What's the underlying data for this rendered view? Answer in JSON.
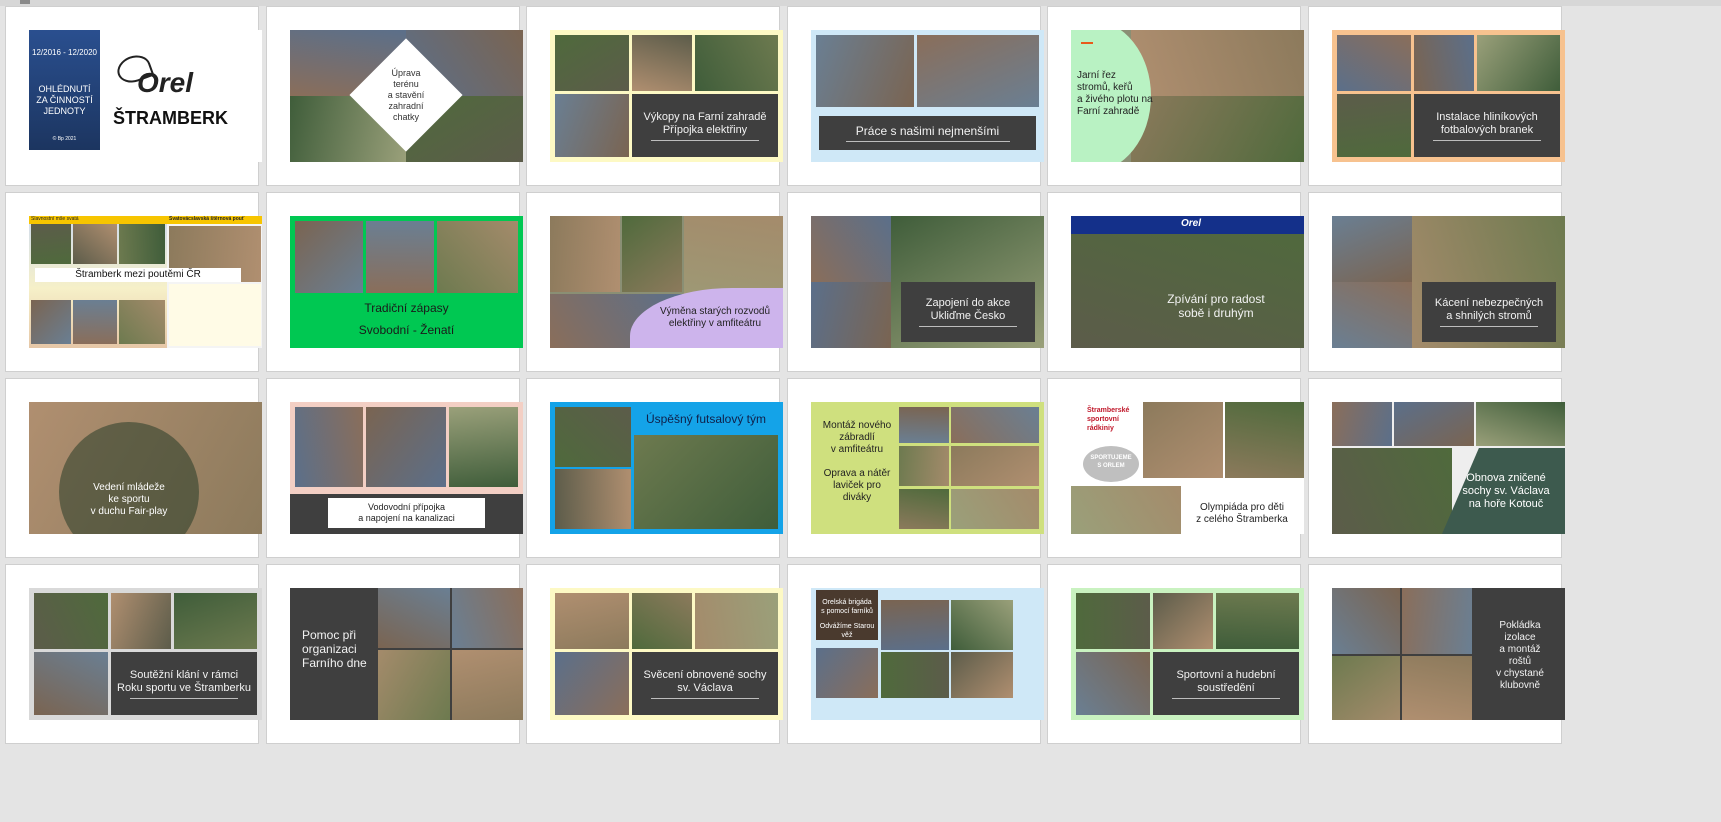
{
  "slides": [
    {
      "kind": "title",
      "date_range": "12/2016 - 12/2020",
      "title": "OHLÉDNUTÍ\nZA ČINNOSTÍ\nJEDNOTY",
      "copyright": "© Bp 2021",
      "logo_word": "Orel",
      "club_name": "ŠTRAMBERK"
    },
    {
      "kind": "diamond",
      "caption": "Úprava\nterénu\na stavění\nzahradní\nchatky"
    },
    {
      "kind": "box-right",
      "accent": "#fdf9c4",
      "caption": "Výkopy na Farní zahradě\nPřípojka elektřiny"
    },
    {
      "kind": "box-bottom",
      "accent": "#cfe8f7",
      "caption": "Práce s našimi nejmenšími"
    },
    {
      "kind": "green-left",
      "accent": "#b9f2c3",
      "caption": "Jarní řez\nstromů, keřů\na živého plotu na\nFarní zahradě"
    },
    {
      "kind": "box-right",
      "accent": "#f7c28f",
      "caption": "Instalace hliníkových\nfotbalových branek"
    },
    {
      "kind": "poster",
      "caption": "Štramberk mezi poutěmi ČR",
      "poster_header_left": "Slavnostní mše svatá",
      "poster_header_right": "Svatovácslavská štěrnová pouť"
    },
    {
      "kind": "green-bottom",
      "accent": "#00c852",
      "caption_line1": "Tradiční zápasy",
      "caption_line2": "Svobodní - Ženatí"
    },
    {
      "kind": "purple-wave",
      "accent": "#cdb4ec",
      "caption": "Výměna starých rozvodů\nelektřiny v amfiteátru"
    },
    {
      "kind": "box-right-dark",
      "caption": "Zapojení do akce\nUkliďme Česko"
    },
    {
      "kind": "overlay",
      "caption": "Zpívání pro radost\nsobě i druhým",
      "banner": "Orel"
    },
    {
      "kind": "box-right-dark",
      "caption": "Kácení nebezpečných\na shnilých stromů"
    },
    {
      "kind": "circle",
      "caption": "Vedení mládeže\nke sportu\nv duchu Fair-play"
    },
    {
      "kind": "white-box",
      "accent": "#f3cfc4",
      "caption": "Vodovodní přípojka\na napojení na kanalizaci"
    },
    {
      "kind": "futsal",
      "accent": "#14a3e8",
      "caption": "Úspěšný futsalový tým"
    },
    {
      "kind": "lime-left",
      "accent": "#cfe07e",
      "caption_line1": "Montáž nového\nzábradlí\nv amfiteátru",
      "caption_line2": "Oprava a nátěr\nlaviček pro\ndiváky"
    },
    {
      "kind": "olympiad",
      "caption": "Olympiáda pro děti\nz celého Štramberka",
      "poster_title": "Štramberské\nsportovní\nrádkiniy",
      "poster_sub": "SPORTUJEME\nS ORLEM"
    },
    {
      "kind": "diagonal",
      "accent": "#3d5a4e",
      "caption": "Obnova zničené\nsochy sv. Václava\nna hoře Kotouč"
    },
    {
      "kind": "box-right-gray",
      "accent": "#d9d9d9",
      "caption": "Soutěžní klání v rámci\nRoku sportu ve Štramberku"
    },
    {
      "kind": "dark-left",
      "caption": "Pomoc při\norganizaci\nFarního dne"
    },
    {
      "kind": "box-right",
      "accent": "#fdf9c4",
      "caption": "Svěcení obnovené sochy\nsv. Václava"
    },
    {
      "kind": "tower",
      "accent": "#cfe8f7",
      "caption_line1": "Orelská brigáda\ns pomocí farníků",
      "caption_line2": "Odvážíme Starou věž"
    },
    {
      "kind": "box-right",
      "accent": "#c9f2c0",
      "caption": "Sportovní a hudební\nsoustředění"
    },
    {
      "kind": "dark-right",
      "caption": "Pokládka\nizolace\na montáž\nroštů\nv chystané\nklubovně"
    }
  ]
}
